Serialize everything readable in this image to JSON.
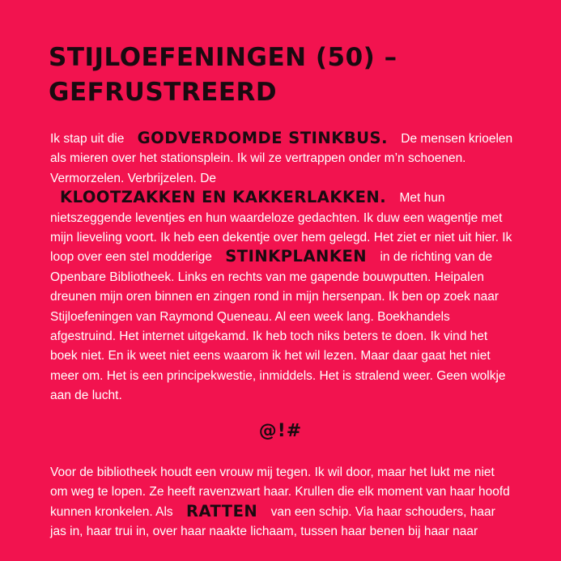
{
  "title": {
    "line1": "Stijloefeningen (50) –",
    "line2": "Gefrustreerd"
  },
  "paragraph1": {
    "s1": "Ik stap uit die",
    "w1": "godverdomde stinkbus.",
    "s2": "De mensen krioelen als mieren over het stationsplein. Ik wil ze vertrappen onder m’n schoenen. Vermorzelen. Verbrijzelen. De",
    "w2": "klootzakken en kakkerlakken.",
    "s3": "Met hun nietszeggende leventjes en hun waardeloze gedachten. Ik duw een wagentje met mijn lieveling voort. Ik heb een dekentje over hem gelegd. Het ziet er niet uit hier. Ik loop over een stel modderige",
    "w3": "stinkplanken",
    "s4": "in de richting van de Openbare Bibliotheek. Links en rechts van me gapende bouwputten. Heipalen dreunen mijn oren binnen en zingen rond in mijn hersenpan. Ik ben op zoek naar Stijloefeningen van Raymond Queneau. Al een week lang. Boekhandels afgestruind. Het internet uitgekamd. Ik heb toch niks beters te doen. Ik vind het boek niet. En ik weet niet eens waarom ik het wil lezen. Maar daar gaat het niet meer om. Het is een principekwestie, inmiddels. Het is stralend weer. Geen wolkje aan de lucht."
  },
  "separator": "@!#",
  "paragraph2": {
    "s1": "Voor de bibliotheek houdt een vrouw mij tegen. Ik wil door, maar het lukt me niet om weg te lopen. Ze heeft ravenzwart haar. Krullen die elk moment van haar hoofd kunnen kronkelen. Als",
    "w1": "ratten",
    "s2": "van een schip. Via haar schouders, haar jas in, haar trui in, over haar naakte lichaam, tussen haar benen bij haar naar"
  },
  "colors": {
    "background": "#f2134f",
    "body_text": "#ffffff",
    "accent_text": "#1a0a10"
  }
}
